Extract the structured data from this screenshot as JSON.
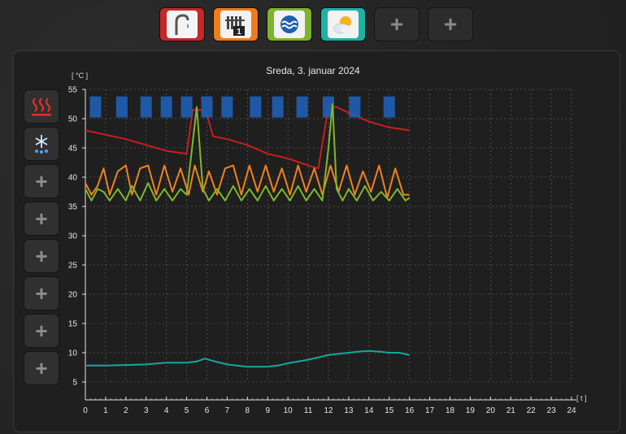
{
  "top_buttons": [
    {
      "name": "water-tap",
      "color": "#c62828"
    },
    {
      "name": "radiator-1",
      "color": "#ef7c1a",
      "badge": "1"
    },
    {
      "name": "water-waves",
      "color": "#7fb32e"
    },
    {
      "name": "weather-sun-cloud",
      "color": "#1fb1a4"
    },
    {
      "name": "add",
      "plus": "+"
    },
    {
      "name": "add",
      "plus": "+"
    }
  ],
  "side_buttons": [
    {
      "name": "heating-icon",
      "glyph": "♨"
    },
    {
      "name": "cooling-icon",
      "glyph": "❄"
    },
    {
      "name": "add",
      "plus": "+"
    },
    {
      "name": "add",
      "plus": "+"
    },
    {
      "name": "add",
      "plus": "+"
    },
    {
      "name": "add",
      "plus": "+"
    },
    {
      "name": "add",
      "plus": "+"
    },
    {
      "name": "add",
      "plus": "+"
    }
  ],
  "chart_data": {
    "type": "line",
    "title": "Sreda, 3. januar 2024",
    "ylabel": "[ °C ]",
    "xlabel": "[ t ]",
    "xlim": [
      0,
      24
    ],
    "ylim": [
      5,
      55
    ],
    "x_ticks": [
      0,
      1,
      2,
      3,
      4,
      5,
      6,
      7,
      8,
      9,
      10,
      11,
      12,
      13,
      14,
      15,
      16,
      17,
      18,
      19,
      20,
      21,
      22,
      23,
      24
    ],
    "y_ticks": [
      5,
      10,
      15,
      20,
      25,
      30,
      35,
      40,
      45,
      50,
      55
    ],
    "grid": true,
    "series": [
      {
        "color": "#c81e1e",
        "kind": "line",
        "x": [
          0,
          2,
          4,
          5,
          5.3,
          5.7,
          6,
          6.3,
          7,
          8,
          9,
          10,
          11,
          11.5,
          12,
          12.4,
          13,
          14,
          15,
          16
        ],
        "y": [
          48,
          46.5,
          44.5,
          44,
          51.5,
          51.5,
          50.8,
          47,
          46.5,
          45.5,
          44,
          43.2,
          42,
          41.5,
          52,
          52,
          51,
          49.5,
          48.5,
          48
        ]
      },
      {
        "color": "#1f5fb5",
        "kind": "blocks",
        "x": [
          0.5,
          1.8,
          3,
          4,
          5,
          6,
          7,
          8.4,
          9.5,
          10.7,
          12,
          13.3,
          15
        ],
        "y": [
          52,
          52,
          52,
          52,
          52,
          52,
          52,
          52,
          52,
          52,
          52,
          52,
          52
        ]
      },
      {
        "color": "#f0821e",
        "kind": "line",
        "x": [
          0,
          0.3,
          0.6,
          0.9,
          1.2,
          1.6,
          2,
          2.3,
          2.7,
          3.1,
          3.5,
          3.9,
          4.3,
          4.7,
          5.1,
          5.4,
          5.8,
          6.1,
          6.5,
          6.9,
          7.3,
          7.7,
          8.1,
          8.5,
          8.9,
          9.3,
          9.7,
          10.1,
          10.5,
          10.9,
          11.3,
          11.7,
          12.1,
          12.5,
          12.9,
          13.3,
          13.7,
          14.1,
          14.5,
          14.9,
          15.3,
          15.7,
          16
        ],
        "y": [
          39,
          37,
          38.5,
          41.5,
          37,
          41,
          42,
          37,
          41.5,
          42,
          37,
          42,
          37.5,
          41.5,
          37,
          42,
          37.5,
          41,
          37,
          41.5,
          42,
          37,
          42,
          37.5,
          42,
          37.5,
          41.5,
          37,
          42,
          37.5,
          41.5,
          37,
          42,
          37.5,
          42,
          37,
          41,
          37.5,
          42,
          36.5,
          41.5,
          37,
          37
        ]
      },
      {
        "color": "#7db82a",
        "kind": "line",
        "x": [
          0,
          0.3,
          0.6,
          0.9,
          1.2,
          1.6,
          2,
          2.3,
          2.7,
          3.1,
          3.5,
          3.9,
          4.3,
          4.7,
          5.0,
          5.3,
          5.5,
          5.8,
          6.1,
          6.5,
          6.9,
          7.3,
          7.7,
          8.1,
          8.5,
          8.9,
          9.3,
          9.7,
          10.1,
          10.5,
          10.9,
          11.3,
          11.7,
          12.0,
          12.2,
          12.4,
          12.7,
          13.0,
          13.4,
          13.8,
          14.2,
          14.6,
          15.0,
          15.4,
          15.8,
          16
        ],
        "y": [
          38,
          36,
          38,
          37.5,
          36,
          38,
          36,
          38.5,
          36,
          39,
          36,
          38,
          36,
          38,
          37,
          46,
          52,
          38,
          36,
          38,
          36,
          38.5,
          36,
          38,
          36,
          38.5,
          36,
          38,
          36,
          38.5,
          36,
          38,
          36,
          45,
          52.5,
          38,
          36,
          38,
          36,
          38.5,
          36,
          37.5,
          36,
          38,
          36,
          36.5
        ]
      },
      {
        "color": "#14a89c",
        "kind": "line",
        "x": [
          0,
          1,
          2,
          3,
          4,
          5,
          5.5,
          5.9,
          6.3,
          7,
          8,
          9,
          9.5,
          10,
          11,
          12,
          13,
          13.5,
          14,
          14.5,
          15,
          15.5,
          16
        ],
        "y": [
          7.8,
          7.8,
          7.9,
          8,
          8.3,
          8.3,
          8.5,
          9,
          8.6,
          8,
          7.6,
          7.6,
          7.8,
          8.2,
          8.8,
          9.6,
          10,
          10.2,
          10.3,
          10.2,
          10,
          10,
          9.6
        ]
      }
    ]
  }
}
